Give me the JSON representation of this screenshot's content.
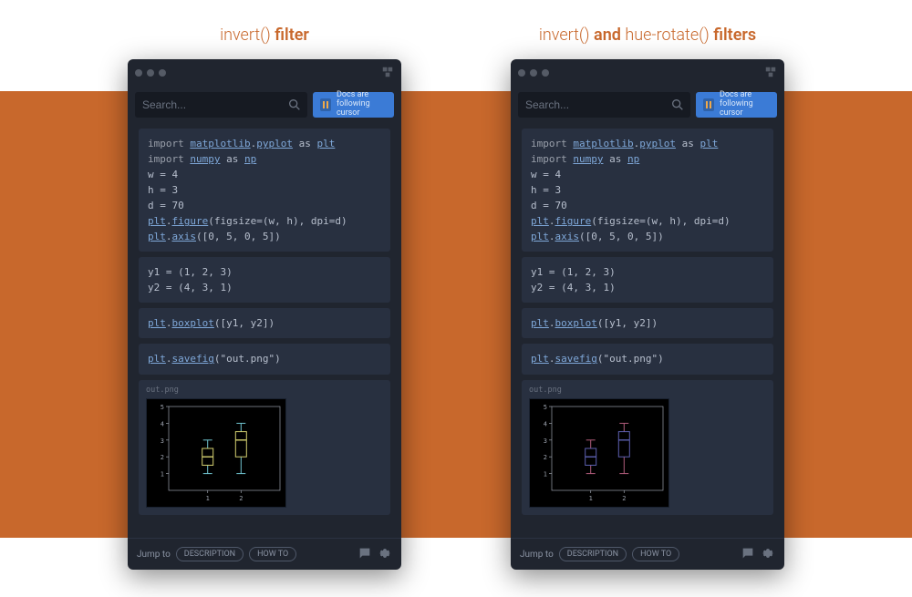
{
  "headings": {
    "left_pre": "invert()",
    "left_post": " filter",
    "right_pre": "invert()",
    "right_mid": " and ",
    "right_pre2": "hue-rotate()",
    "right_post": " filters"
  },
  "search": {
    "placeholder": "Search..."
  },
  "docs_btn": {
    "label": "Docs are\nfollowing cursor"
  },
  "code": {
    "block1": [
      {
        "t": "kw",
        "s": "import "
      },
      {
        "t": "link",
        "s": "matplotlib"
      },
      {
        "t": "",
        "s": "."
      },
      {
        "t": "link",
        "s": "pyplot"
      },
      {
        "t": "",
        "s": " as "
      },
      {
        "t": "link",
        "s": "plt"
      },
      {
        "t": "br"
      },
      {
        "t": "kw",
        "s": "import "
      },
      {
        "t": "link",
        "s": "numpy"
      },
      {
        "t": "",
        "s": " as "
      },
      {
        "t": "link",
        "s": "np"
      },
      {
        "t": "br"
      },
      {
        "t": "",
        "s": "w = 4"
      },
      {
        "t": "br"
      },
      {
        "t": "",
        "s": "h = 3"
      },
      {
        "t": "br"
      },
      {
        "t": "",
        "s": "d = 70"
      },
      {
        "t": "br"
      },
      {
        "t": "link",
        "s": "plt"
      },
      {
        "t": "",
        "s": "."
      },
      {
        "t": "link",
        "s": "figure"
      },
      {
        "t": "",
        "s": "(figsize=(w, h), dpi=d)"
      },
      {
        "t": "br"
      },
      {
        "t": "link",
        "s": "plt"
      },
      {
        "t": "",
        "s": "."
      },
      {
        "t": "link",
        "s": "axis"
      },
      {
        "t": "",
        "s": "([0, 5, 0, 5])"
      }
    ],
    "block2": [
      {
        "t": "",
        "s": "y1 = (1, 2, 3)"
      },
      {
        "t": "br"
      },
      {
        "t": "",
        "s": "y2 = (4, 3, 1)"
      }
    ],
    "block3": [
      {
        "t": "link",
        "s": "plt"
      },
      {
        "t": "",
        "s": "."
      },
      {
        "t": "link",
        "s": "boxplot"
      },
      {
        "t": "",
        "s": "([y1, y2])"
      }
    ],
    "block4": [
      {
        "t": "link",
        "s": "plt"
      },
      {
        "t": "",
        "s": "."
      },
      {
        "t": "link",
        "s": "savefig"
      },
      {
        "t": "",
        "s": "(\"out.png\")"
      }
    ],
    "out_caption": "out.png"
  },
  "chart_data": {
    "type": "boxplot",
    "categories": [
      "1",
      "2"
    ],
    "series": [
      {
        "name": "y1",
        "min": 1,
        "q1": 1.5,
        "median": 2,
        "q3": 2.5,
        "max": 3
      },
      {
        "name": "y2",
        "min": 1,
        "q1": 2,
        "median": 3,
        "q3": 3.5,
        "max": 4
      }
    ],
    "xlim": [
      0,
      5
    ],
    "ylim": [
      0,
      5
    ],
    "yticks": [
      1,
      2,
      3,
      4,
      5
    ],
    "left_panel_colors": {
      "box": "#d4d070",
      "whisker": "#70c4d0"
    },
    "right_panel_colors": {
      "box": "#5c5fb0",
      "whisker": "#b05c7a"
    }
  },
  "footer": {
    "jump": "Jump to",
    "desc": "DESCRIPTION",
    "howto": "HOW TO"
  }
}
